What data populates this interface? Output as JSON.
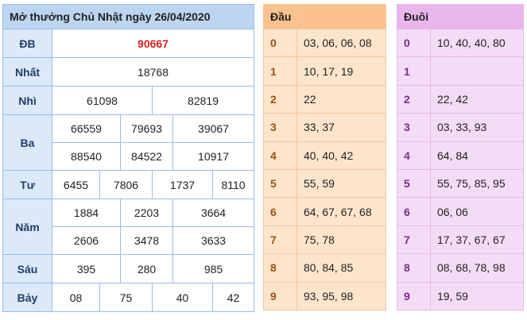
{
  "results": {
    "title": "Mở thưởng Chủ Nhật ngày 26/04/2020",
    "rows": {
      "db": {
        "label": "ĐB",
        "values": [
          "90667"
        ]
      },
      "nhat": {
        "label": "Nhất",
        "values": [
          "18768"
        ]
      },
      "nhi": {
        "label": "Nhì",
        "values": [
          "61098",
          "82819"
        ]
      },
      "ba": {
        "label": "Ba",
        "values": [
          "66559",
          "79693",
          "39067",
          "88540",
          "84522",
          "10917"
        ]
      },
      "tu": {
        "label": "Tư",
        "values": [
          "6455",
          "7806",
          "1737",
          "8110"
        ]
      },
      "nam": {
        "label": "Năm",
        "values": [
          "1884",
          "2203",
          "3664",
          "2606",
          "3478",
          "3633"
        ]
      },
      "sau": {
        "label": "Sáu",
        "values": [
          "395",
          "280",
          "985"
        ]
      },
      "bay": {
        "label": "Bảy",
        "values": [
          "08",
          "75",
          "40",
          "42"
        ]
      }
    },
    "special_color": "#d61e1e"
  },
  "dau": {
    "header": "Đầu",
    "rows": [
      {
        "key": "0",
        "nums": "03, 06, 06, 08"
      },
      {
        "key": "1",
        "nums": "10, 17, 19"
      },
      {
        "key": "2",
        "nums": "22"
      },
      {
        "key": "3",
        "nums": "33, 37"
      },
      {
        "key": "4",
        "nums": "40, 40, 42"
      },
      {
        "key": "5",
        "nums": "55, 59"
      },
      {
        "key": "6",
        "nums": "64, 67, 67, 68"
      },
      {
        "key": "7",
        "nums": "75, 78"
      },
      {
        "key": "8",
        "nums": "80, 84, 85"
      },
      {
        "key": "9",
        "nums": "93, 95, 98"
      }
    ]
  },
  "duoi": {
    "header": "Đuôi",
    "rows": [
      {
        "key": "0",
        "nums": "10, 40, 40, 80"
      },
      {
        "key": "1",
        "nums": ""
      },
      {
        "key": "2",
        "nums": "22, 42"
      },
      {
        "key": "3",
        "nums": "03, 33, 93"
      },
      {
        "key": "4",
        "nums": "64, 84"
      },
      {
        "key": "5",
        "nums": "55, 75, 85, 95"
      },
      {
        "key": "6",
        "nums": "06, 06"
      },
      {
        "key": "7",
        "nums": "17, 37, 67, 67"
      },
      {
        "key": "8",
        "nums": "08, 68, 78, 98"
      },
      {
        "key": "9",
        "nums": "19, 59"
      }
    ]
  }
}
